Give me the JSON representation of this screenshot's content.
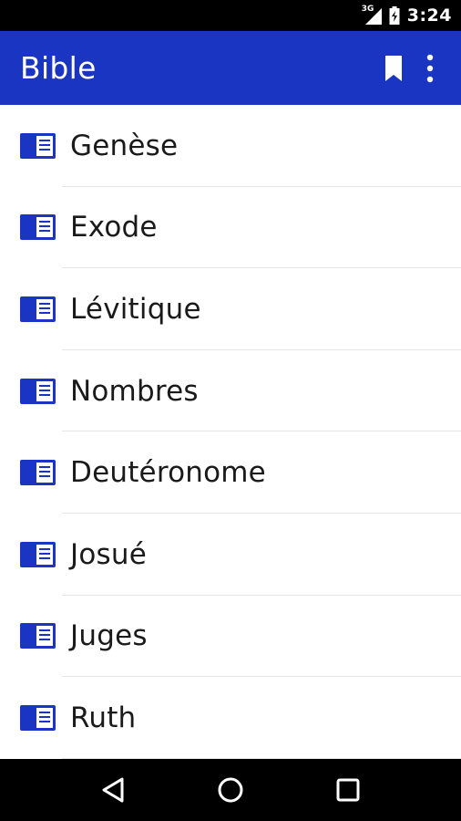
{
  "status_bar": {
    "network": "3G",
    "time": "3:24"
  },
  "app_bar": {
    "title": "Bible",
    "icons": [
      "bookmark-icon",
      "more-vert-icon"
    ]
  },
  "books": [
    {
      "label": "Genèse"
    },
    {
      "label": "Exode"
    },
    {
      "label": "Lévitique"
    },
    {
      "label": "Nombres"
    },
    {
      "label": "Deutéronome"
    },
    {
      "label": "Josué"
    },
    {
      "label": "Juges"
    },
    {
      "label": "Ruth"
    }
  ],
  "nav_bar": {
    "icons": [
      "back-icon",
      "home-icon",
      "recents-icon"
    ]
  },
  "colors": {
    "primary": "#1a35c2",
    "book_icon": "#1a35c2",
    "status_bar": "#000000"
  }
}
